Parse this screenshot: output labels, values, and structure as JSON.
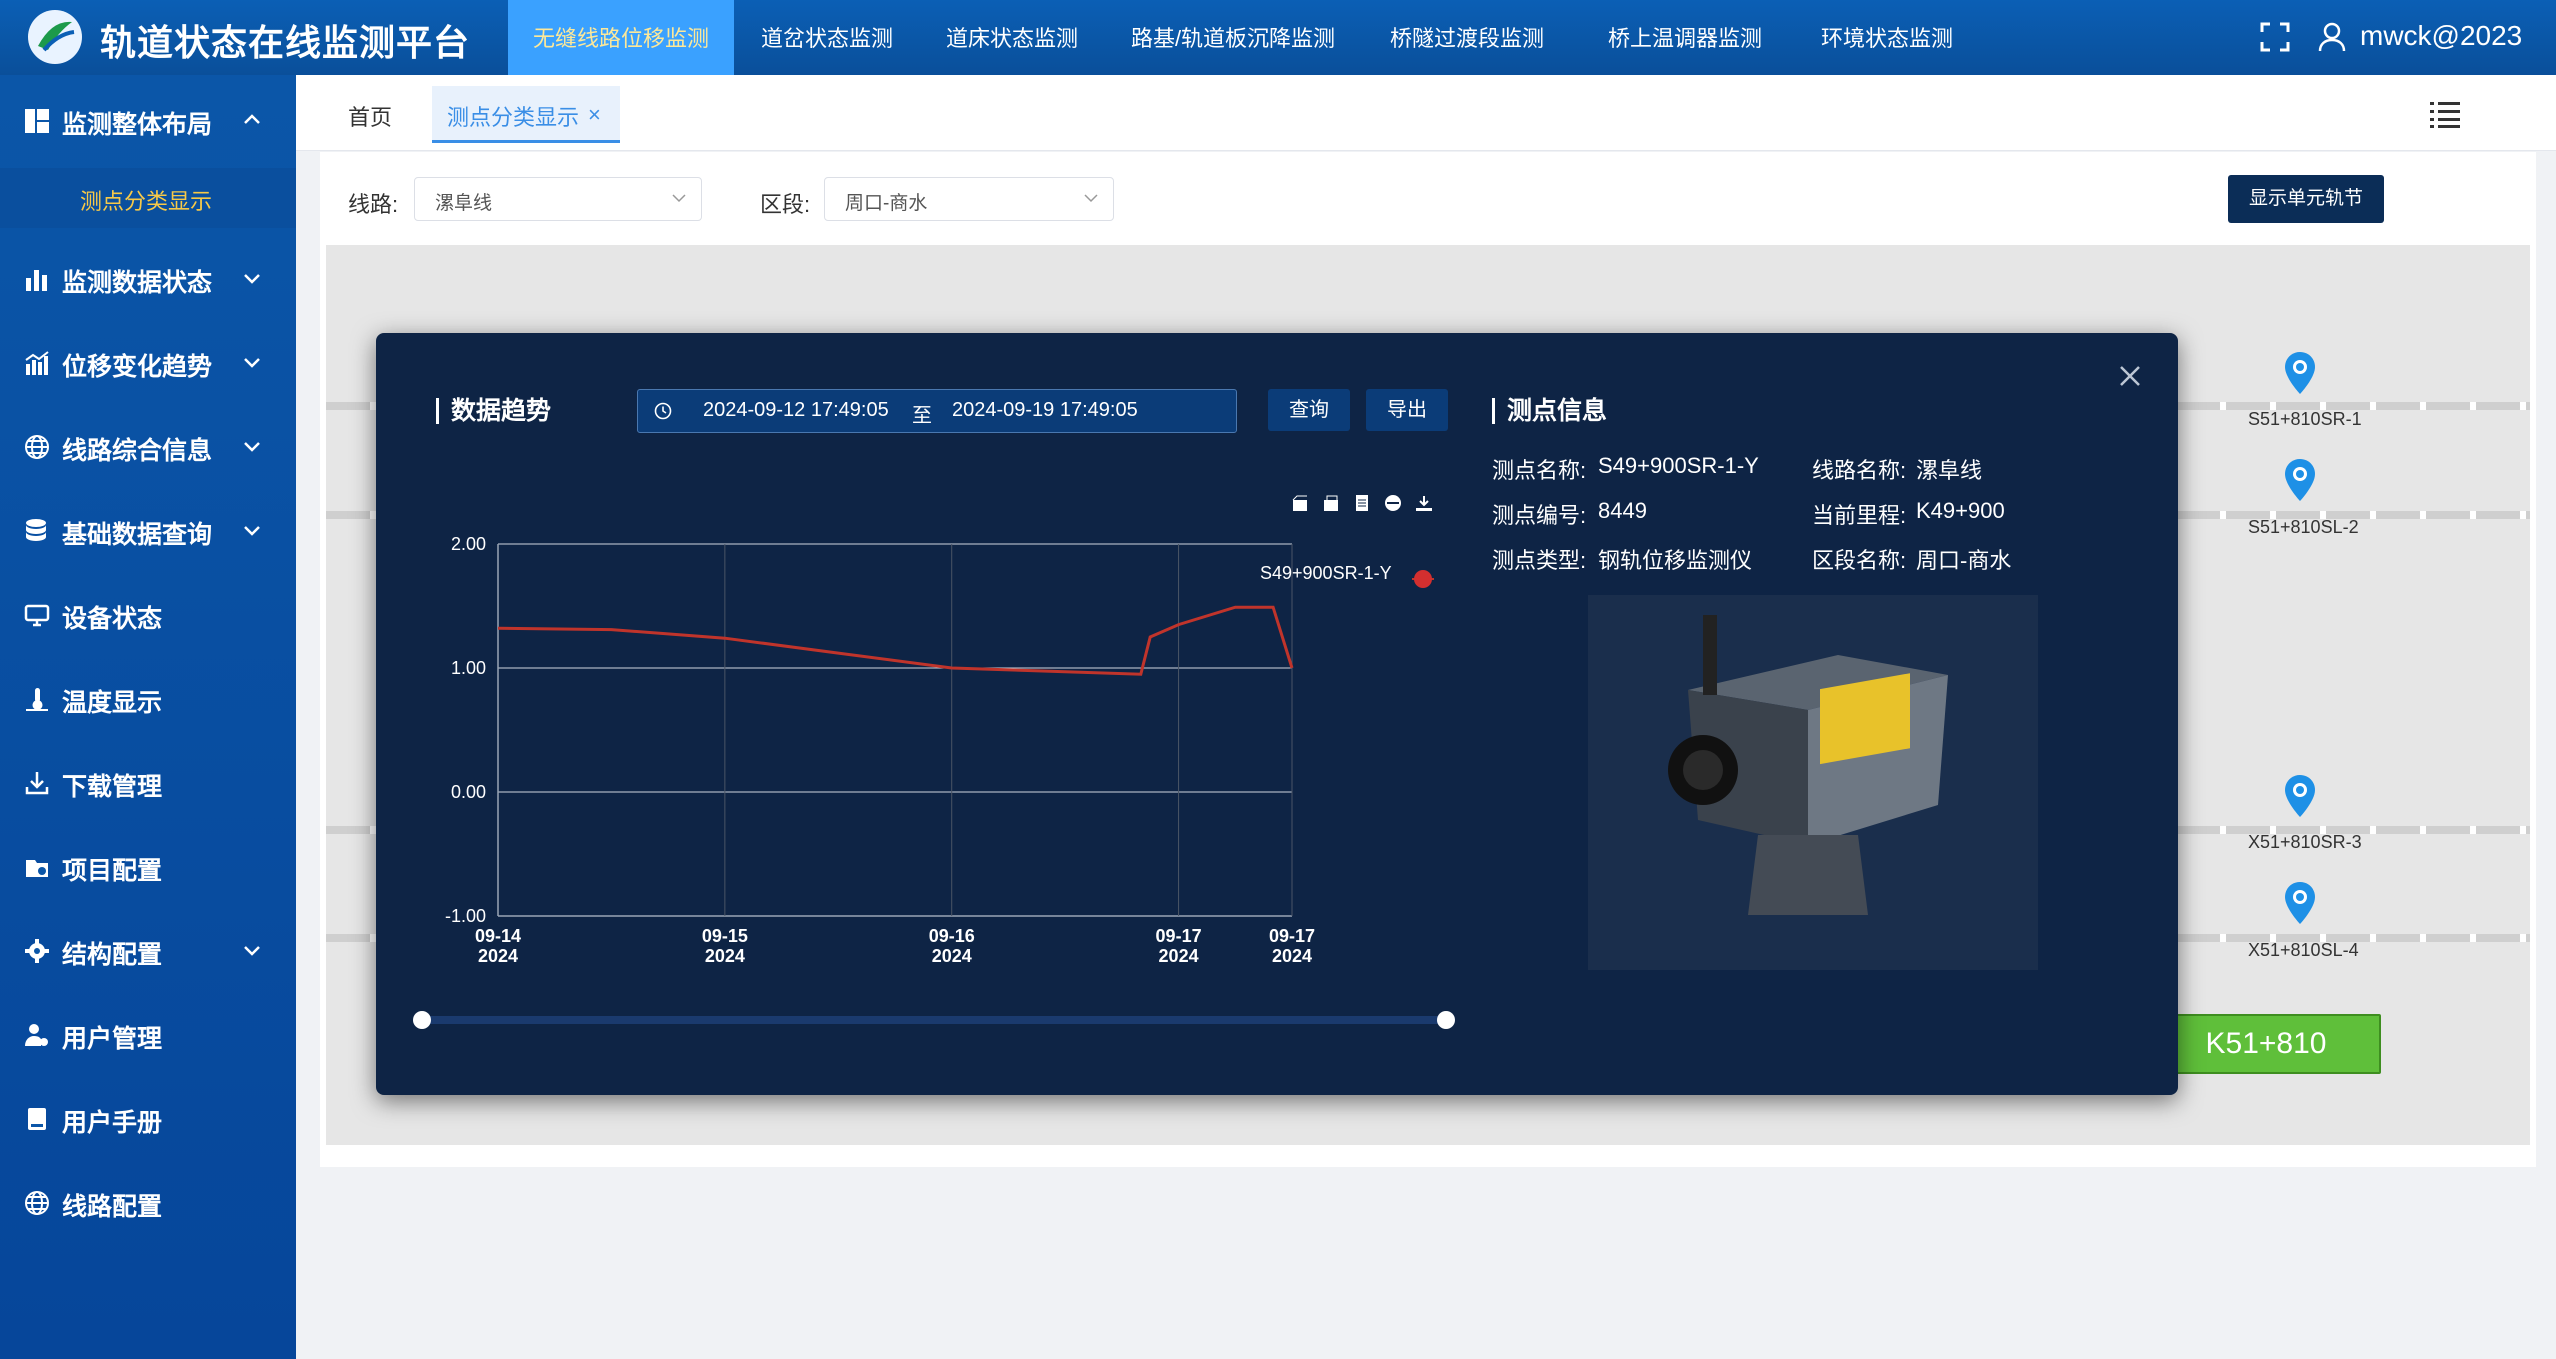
{
  "app": {
    "title": "轨道状态在线监测平台",
    "username": "mwck@2023"
  },
  "topnav": [
    {
      "label": "无缝线路位移监测",
      "active": true
    },
    {
      "label": "道岔状态监测"
    },
    {
      "label": "道床状态监测"
    },
    {
      "label": "路基/轨道板沉降监测"
    },
    {
      "label": "桥隧过渡段监测"
    },
    {
      "label": "桥上温调器监测"
    },
    {
      "label": "环境状态监测"
    }
  ],
  "sidebar": {
    "items": [
      {
        "label": "监测整体布局",
        "icon": "layout-icon",
        "expanded": true
      },
      {
        "label": "监测数据状态",
        "icon": "bar-chart-icon"
      },
      {
        "label": "位移变化趋势",
        "icon": "trend-chart-icon"
      },
      {
        "label": "线路综合信息",
        "icon": "globe-icon"
      },
      {
        "label": "基础数据查询",
        "icon": "database-icon"
      },
      {
        "label": "设备状态",
        "icon": "monitor-icon"
      },
      {
        "label": "温度显示",
        "icon": "thermometer-icon"
      },
      {
        "label": "下载管理",
        "icon": "download-icon"
      },
      {
        "label": "项目配置",
        "icon": "folder-config-icon"
      },
      {
        "label": "结构配置",
        "icon": "gear-icon"
      },
      {
        "label": "用户管理",
        "icon": "user-settings-icon"
      },
      {
        "label": "用户手册",
        "icon": "book-icon"
      },
      {
        "label": "线路配置",
        "icon": "globe-icon"
      }
    ],
    "sub_active": "测点分类显示"
  },
  "tabs": {
    "home": "首页",
    "active": "测点分类显示",
    "close": "×"
  },
  "filters": {
    "line_label": "线路:",
    "line_value": "漯阜线",
    "section_label": "区段:",
    "section_value": "周口-商水",
    "show_unit_button": "显示单元轨节"
  },
  "map": {
    "right_markers": [
      "S51+810SR-1",
      "S51+810SL-2",
      "X51+810SR-3",
      "X51+810SL-4"
    ],
    "station_current": "K51+810"
  },
  "modal": {
    "trend_title": "数据趋势",
    "date_start": "2024-09-12 17:49:05",
    "date_sep": "至",
    "date_end": "2024-09-19 17:49:05",
    "query_button": "查询",
    "export_button": "导出",
    "info_title": "测点信息",
    "info": {
      "name_key": "测点名称:",
      "name_val": "S49+900SR-1-Y",
      "line_key": "线路名称:",
      "line_val": "漯阜线",
      "code_key": "测点编号:",
      "code_val": "8449",
      "mileage_key": "当前里程:",
      "mileage_val": "K49+900",
      "type_key": "测点类型:",
      "type_val": "钢轨位移监测仪",
      "section_key": "区段名称:",
      "section_val": "周口-商水"
    }
  },
  "chart_data": {
    "type": "line",
    "series": [
      {
        "name": "S49+900SR-1-Y",
        "color": "#c0342b",
        "x": [
          "09-14 00:00",
          "09-14 12:00",
          "09-15 00:00",
          "09-15 12:00",
          "09-16 00:00",
          "09-16 12:00",
          "09-16 20:00",
          "09-16 21:00",
          "09-17 00:00",
          "09-17 06:00",
          "09-17 10:00",
          "09-17 12:00"
        ],
        "values": [
          1.32,
          1.31,
          1.24,
          1.12,
          1.0,
          0.97,
          0.95,
          1.25,
          1.35,
          1.49,
          1.49,
          1.0
        ]
      }
    ],
    "x_ticks": [
      "09-14\n2024",
      "09-15\n2024",
      "09-16\n2024",
      "09-17\n2024",
      "09-17\n2024"
    ],
    "y_ticks": [
      "2.00",
      "1.00",
      "0.00",
      "-1.00"
    ],
    "ylim": [
      -1,
      2
    ],
    "grid": true,
    "legend": "top-right"
  }
}
